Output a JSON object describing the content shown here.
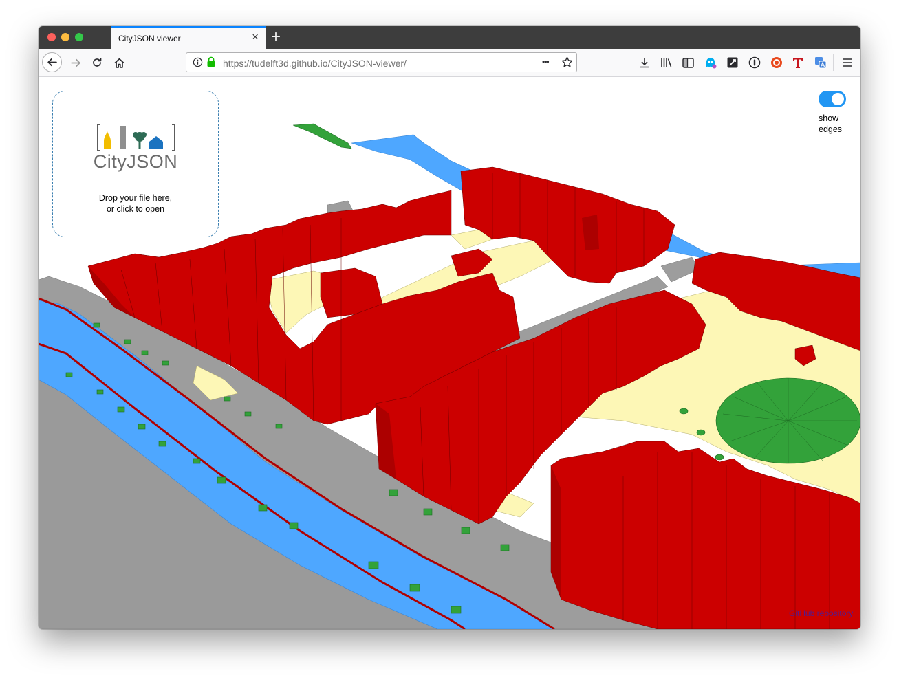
{
  "browser": {
    "tab_title": "CityJSON viewer",
    "tab_close": "×",
    "new_tab": "+",
    "url_host": "https://tudelft3d.github.io",
    "url_path": "/CityJSON-viewer/",
    "page_actions": "•••",
    "toolbar_icons": [
      "download-icon",
      "library-icon",
      "sidebar-icon",
      "ghostery-icon",
      "extension-icon",
      "lastpass-icon",
      "ublock-icon",
      "font-t-icon",
      "translate-icon",
      "menu-icon"
    ]
  },
  "dropzone": {
    "logo_text": "CityJSON",
    "line1": "Drop your file here,",
    "line2": "or click to open"
  },
  "toggle": {
    "label_line1": "show",
    "label_line2": "edges",
    "checked": true
  },
  "footer": {
    "github_link": "GitHub repository"
  },
  "colors": {
    "building": "#cc0000",
    "water": "#4ea7ff",
    "road": "#9d9d9d",
    "plant_cover": "#33a23a",
    "land_use": "#fdf7b6",
    "toggle_on": "#2196f3",
    "url_lock": "#12bc00"
  }
}
